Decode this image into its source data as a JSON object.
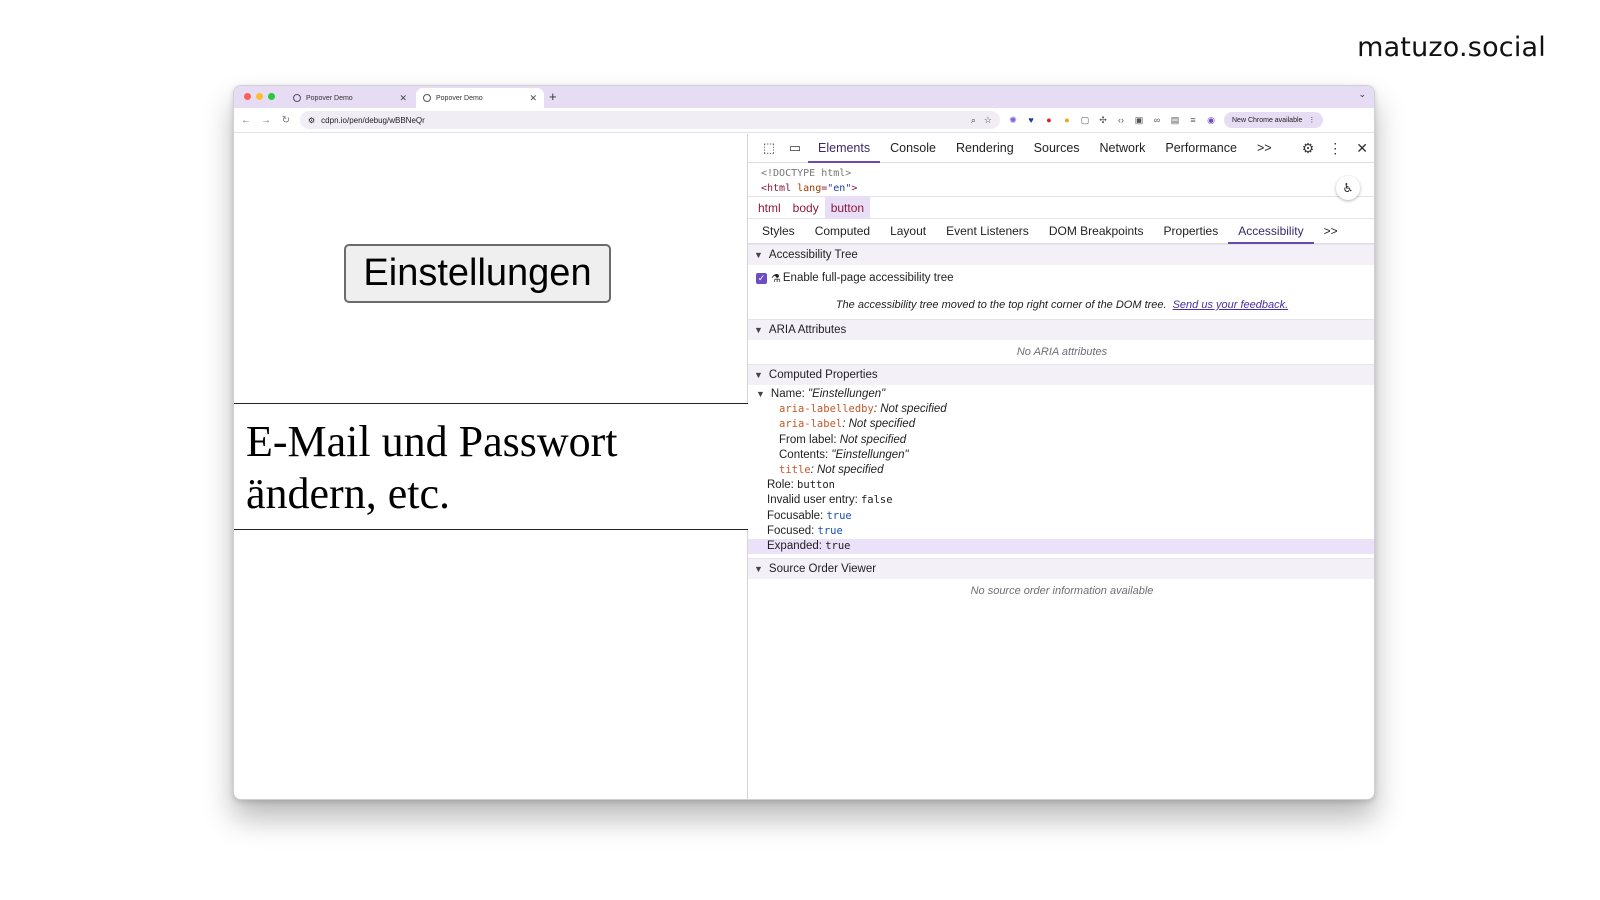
{
  "brand": "matuzo.social",
  "browser": {
    "tabs": [
      {
        "title": "Popover Demo",
        "active": false
      },
      {
        "title": "Popover Demo",
        "active": true
      }
    ],
    "new_tab": "+",
    "url": "cdpn.io/pen/debug/wBBNeQr",
    "new_chrome": "New Chrome available"
  },
  "page": {
    "button_label": "Einstellungen",
    "popover_text": "E-Mail und Passwort ändern, etc."
  },
  "devtools": {
    "tabs": [
      "Elements",
      "Console",
      "Rendering",
      "Sources",
      "Network",
      "Performance"
    ],
    "more": ">>",
    "dom": {
      "doctype": "<!DOCTYPE html>",
      "html_open": "<html",
      "attr": "lang",
      "val": "\"en\"",
      "close": ">"
    },
    "breadcrumbs": [
      "html",
      "body",
      "button"
    ],
    "subtabs": [
      "Styles",
      "Computed",
      "Layout",
      "Event Listeners",
      "DOM Breakpoints",
      "Properties",
      "Accessibility"
    ],
    "sections": {
      "tree": "Accessibility Tree",
      "enable": "Enable full-page accessibility tree",
      "note": "The accessibility tree moved to the top right corner of the DOM tree.",
      "feedback": "Send us your feedback.",
      "aria": "ARIA Attributes",
      "aria_empty": "No ARIA attributes",
      "computed": "Computed Properties",
      "source": "Source Order Viewer",
      "source_empty": "No source order information available"
    },
    "computed_props": {
      "name_key": "Name: ",
      "name_val": "\"Einstellungen\"",
      "labelledby_key": "aria-labelledby",
      "labelledby_val": ": Not specified",
      "label_key": "aria-label",
      "label_val": ": Not specified",
      "from_label_key": "From label: ",
      "from_label_val": "Not specified",
      "contents_key": "Contents: ",
      "contents_val": "\"Einstellungen\"",
      "title_key": "title",
      "title_val": ": Not specified",
      "role_key": "Role: ",
      "role_val": "button",
      "invalid_key": "Invalid user entry: ",
      "invalid_val": "false",
      "focusable_key": "Focusable: ",
      "focusable_val": "true",
      "focused_key": "Focused: ",
      "focused_val": "true",
      "expanded_key": "Expanded: ",
      "expanded_val": "true"
    }
  }
}
